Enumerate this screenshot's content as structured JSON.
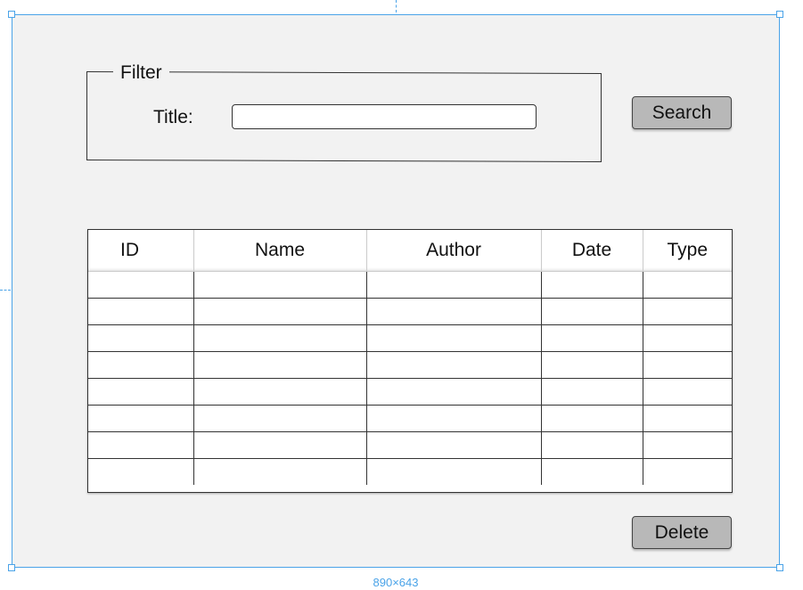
{
  "canvas": {
    "size_label": "890×643"
  },
  "filter": {
    "legend": "Filter",
    "title_label": "Title:",
    "title_value": ""
  },
  "buttons": {
    "search_label": "Search",
    "delete_label": "Delete"
  },
  "table": {
    "columns": [
      "ID",
      "Name",
      "Author",
      "Date",
      "Type"
    ],
    "rows": [
      [
        "",
        "",
        "",
        "",
        ""
      ],
      [
        "",
        "",
        "",
        "",
        ""
      ],
      [
        "",
        "",
        "",
        "",
        ""
      ],
      [
        "",
        "",
        "",
        "",
        ""
      ],
      [
        "",
        "",
        "",
        "",
        ""
      ],
      [
        "",
        "",
        "",
        "",
        ""
      ],
      [
        "",
        "",
        "",
        "",
        ""
      ],
      [
        "",
        "",
        "",
        "",
        ""
      ]
    ]
  },
  "colors": {
    "selection": "#4aa3e8",
    "canvas_bg": "#f2f2f2",
    "button_bg": "#b8b8b8"
  }
}
